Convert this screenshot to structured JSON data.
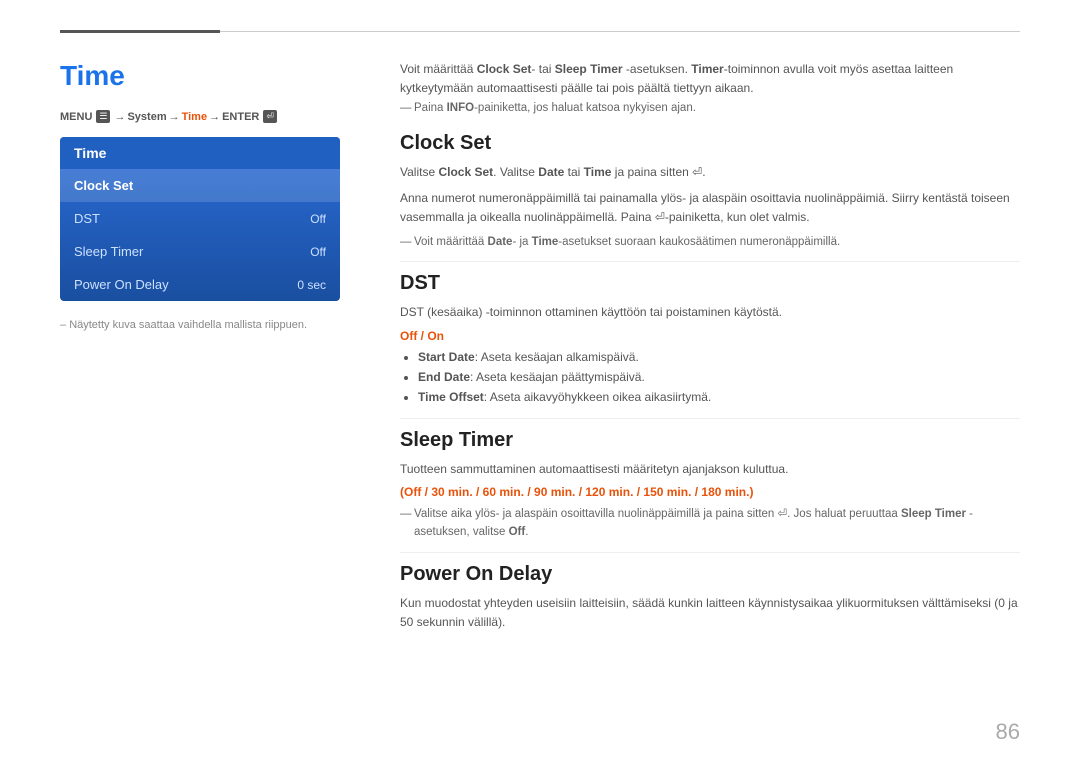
{
  "topbar": {},
  "left": {
    "title": "Time",
    "menu_path": {
      "prefix": "MENU",
      "items": [
        "System",
        "Time",
        "ENTER"
      ]
    },
    "tv_menu": {
      "header": "Time",
      "items": [
        {
          "label": "Clock Set",
          "value": "",
          "selected": true
        },
        {
          "label": "DST",
          "value": "Off"
        },
        {
          "label": "Sleep Timer",
          "value": "Off"
        },
        {
          "label": "Power On Delay",
          "value": "0 sec"
        }
      ]
    },
    "footnote": "Näytetty kuva saattaa vaihdella mallista riippuen."
  },
  "right": {
    "intro": "Voit määrittää Clock Set- tai Sleep Timer -asetuksen. Timer-toiminnon avulla voit myös asettaa laitteen kytkeytymään automaattisesti päälle tai pois päältä tiettyyn aikaan.",
    "intro_note": "Paina INFO-painiketta, jos haluat katsoa nykyisen ajan.",
    "sections": [
      {
        "id": "clock-set",
        "title": "Clock Set",
        "body1": "Valitse Clock Set. Valitse Date tai Time ja paina sitten ⏎.",
        "body2": "Anna numerot numeronäppäimillä tai painamalla ylös- ja alaspäin osoittavia nuolinäppäimiä. Siirry kentästä toiseen vasemmalla ja oikealla nuolinäppäimellä. Paina ⏎-painiketta, kun olet valmis.",
        "note": "Voit määrittää Date- ja Time-asetukset suoraan kaukosäätimen numeronäppäimillä."
      },
      {
        "id": "dst",
        "title": "DST",
        "body1": "DST (kesäaika) -toiminnon ottaminen käyttöön tai poistaminen käytöstä.",
        "orange_label": "Off / On",
        "bullets": [
          {
            "label": "Start Date",
            "text": "Aseta kesäajan alkamispäivä."
          },
          {
            "label": "End Date",
            "text": "Aseta kesäajan päättymispäivä."
          },
          {
            "label": "Time Offset",
            "text": "Aseta aikavyöhykkeen oikea aikasiirtymä."
          }
        ]
      },
      {
        "id": "sleep-timer",
        "title": "Sleep Timer",
        "body1": "Tuotteen sammuttaminen automaattisesti määritetyn ajanjakson kuluttua.",
        "options": "(Off / 30 min. / 60 min. / 90 min. / 120 min. / 150 min. / 180 min.)",
        "note": "Valitse aika ylös- ja alaspäin osoittavilla nuolinäppäimillä ja paina sitten ⏎. Jos haluat peruuttaa Sleep Timer -asetuksen, valitse Off."
      },
      {
        "id": "power-on-delay",
        "title": "Power On Delay",
        "body1": "Kun muodostat yhteyden useisiin laitteisiin, säädä kunkin laitteen käynnistysaikaa ylikuormituksen välttämiseksi (0 ja 50 sekunnin välillä)."
      }
    ]
  },
  "page_number": "86"
}
